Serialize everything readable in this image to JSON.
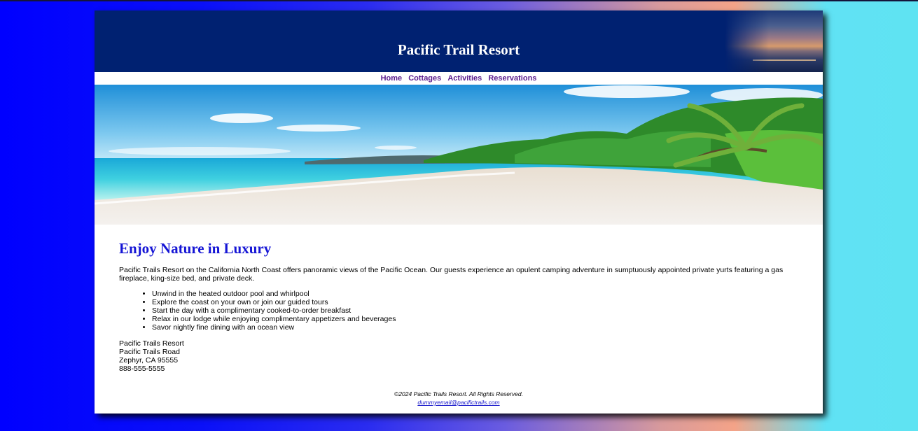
{
  "header": {
    "title": "Pacific Trail Resort"
  },
  "nav": {
    "items": [
      "Home",
      "Cottages",
      "Activities",
      "Reservations"
    ]
  },
  "main": {
    "heading": "Enjoy Nature in Luxury",
    "intro": "Pacific Trails Resort on the California North Coast offers panoramic views of the Pacific Ocean. Our guests experience an opulent camping adventure in sumptuously appointed private yurts featuring a gas fireplace, king-size bed, and private deck.",
    "features": [
      "Unwind in the heated outdoor pool and whirlpool",
      "Explore the coast on your own or join our guided tours",
      "Start the day with a complimentary cooked-to-order breakfast",
      "Relax in our lodge while enjoying complimentary appetizers and beverages",
      "Savor nightly fine dining with an ocean view"
    ]
  },
  "contact": {
    "name": "Pacific Trails Resort",
    "street": "Pacific Trails Road",
    "city": "Zephyr, CA 95555",
    "phone": "888-555-5555"
  },
  "footer": {
    "copyright": "©2024 Pacific Trails Resort. All Rights Reserved.",
    "email": "dummyemail@pacifictrails.com"
  }
}
